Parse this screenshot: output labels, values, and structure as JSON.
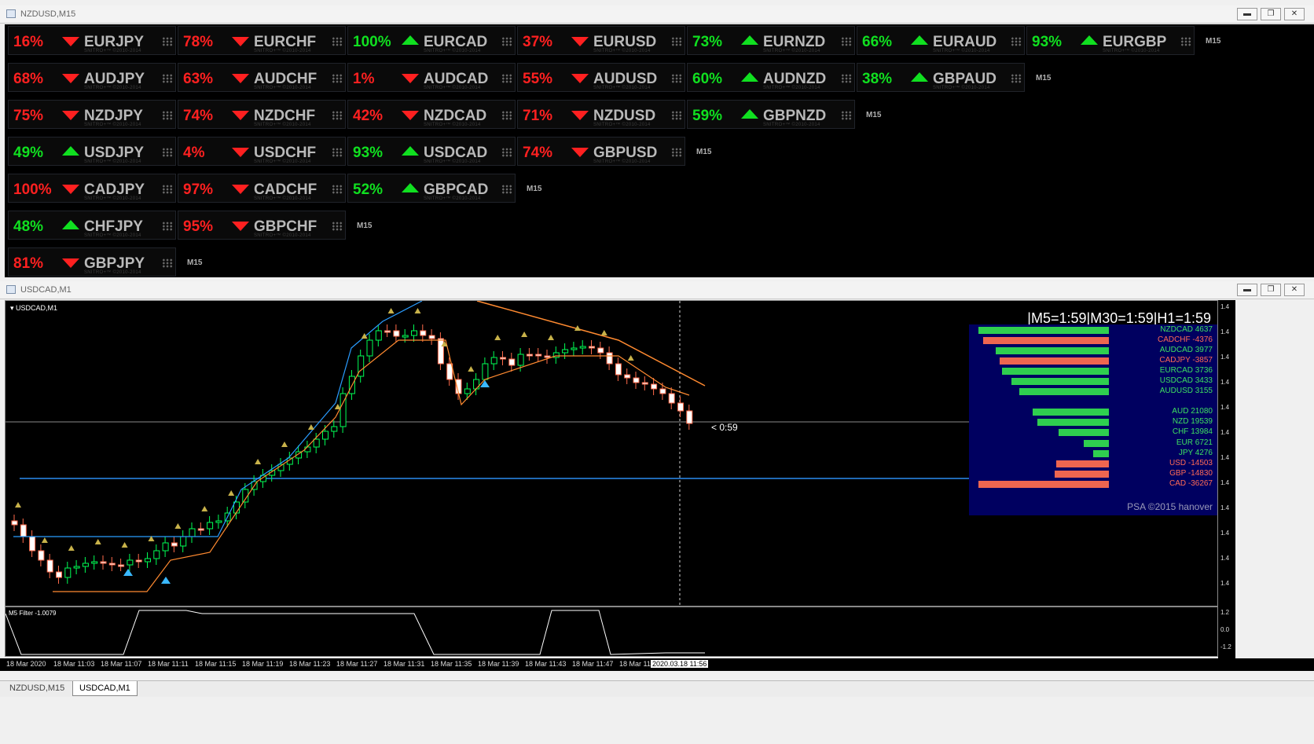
{
  "windows": {
    "top_title": "NZDUSD,M15",
    "bottom_title": "USDCAD,M1"
  },
  "watermark": "SNITRO+™ ©2010-2014",
  "tf_label": "M15",
  "colors": {
    "up": "#10e020",
    "down": "#ff2020",
    "bull": "#00ff66",
    "bear": "#ff6a4a",
    "panel": "#000060"
  },
  "rows": [
    [
      {
        "pct": "16%",
        "dir": "down",
        "pair": "EURJPY"
      },
      {
        "pct": "78%",
        "dir": "down",
        "pair": "EURCHF"
      },
      {
        "pct": "100%",
        "dir": "up",
        "pair": "EURCAD"
      },
      {
        "pct": "37%",
        "dir": "down",
        "pair": "EURUSD"
      },
      {
        "pct": "73%",
        "dir": "up",
        "pair": "EURNZD"
      },
      {
        "pct": "66%",
        "dir": "up",
        "pair": "EURAUD"
      },
      {
        "pct": "93%",
        "dir": "up",
        "pair": "EURGBP"
      }
    ],
    [
      {
        "pct": "68%",
        "dir": "down",
        "pair": "AUDJPY"
      },
      {
        "pct": "63%",
        "dir": "down",
        "pair": "AUDCHF"
      },
      {
        "pct": "1%",
        "dir": "down",
        "pair": "AUDCAD"
      },
      {
        "pct": "55%",
        "dir": "down",
        "pair": "AUDUSD"
      },
      {
        "pct": "60%",
        "dir": "up",
        "pair": "AUDNZD"
      },
      {
        "pct": "38%",
        "dir": "up",
        "pair": "GBPAUD"
      }
    ],
    [
      {
        "pct": "75%",
        "dir": "down",
        "pair": "NZDJPY"
      },
      {
        "pct": "74%",
        "dir": "down",
        "pair": "NZDCHF"
      },
      {
        "pct": "42%",
        "dir": "down",
        "pair": "NZDCAD"
      },
      {
        "pct": "71%",
        "dir": "down",
        "pair": "NZDUSD"
      },
      {
        "pct": "59%",
        "dir": "up",
        "pair": "GBPNZD"
      }
    ],
    [
      {
        "pct": "49%",
        "dir": "up",
        "pair": "USDJPY"
      },
      {
        "pct": "4%",
        "dir": "down",
        "pair": "USDCHF"
      },
      {
        "pct": "93%",
        "dir": "up",
        "pair": "USDCAD"
      },
      {
        "pct": "74%",
        "dir": "down",
        "pair": "GBPUSD"
      }
    ],
    [
      {
        "pct": "100%",
        "dir": "down",
        "pair": "CADJPY"
      },
      {
        "pct": "97%",
        "dir": "down",
        "pair": "CADCHF"
      },
      {
        "pct": "52%",
        "dir": "up",
        "pair": "GBPCAD"
      }
    ],
    [
      {
        "pct": "48%",
        "dir": "up",
        "pair": "CHFJPY"
      },
      {
        "pct": "95%",
        "dir": "down",
        "pair": "GBPCHF"
      }
    ],
    [
      {
        "pct": "81%",
        "dir": "down",
        "pair": "GBPJPY"
      }
    ]
  ],
  "chart": {
    "symbol_label": "USDCAD,M1",
    "countdown_header": "|M5=1:59|M30=1:59|H1=1:59",
    "bar_timer": "< 0:59",
    "filter_label": "M5 Filter -1.0079",
    "copyright": "PSA ©2015 hanover",
    "pairs": [
      {
        "name": "NZDCAD",
        "value": "4637",
        "dir": "up",
        "frac": 0.99
      },
      {
        "name": "CADCHF",
        "value": "-4376",
        "dir": "down",
        "frac": 0.95
      },
      {
        "name": "AUDCAD",
        "value": "3977",
        "dir": "up",
        "frac": 0.86
      },
      {
        "name": "CADJPY",
        "value": "-3857",
        "dir": "down",
        "frac": 0.83
      },
      {
        "name": "EURCAD",
        "value": "3736",
        "dir": "up",
        "frac": 0.81
      },
      {
        "name": "USDCAD",
        "value": "3433",
        "dir": "up",
        "frac": 0.74
      },
      {
        "name": "AUDUSD",
        "value": "3155",
        "dir": "up",
        "frac": 0.68
      }
    ],
    "currencies": [
      {
        "name": "AUD",
        "value": "21080",
        "dir": "up",
        "frac": 0.58
      },
      {
        "name": "NZD",
        "value": "19539",
        "dir": "up",
        "frac": 0.54
      },
      {
        "name": "CHF",
        "value": "13984",
        "dir": "up",
        "frac": 0.38
      },
      {
        "name": "EUR",
        "value": "6721",
        "dir": "up",
        "frac": 0.19
      },
      {
        "name": "JPY",
        "value": "4276",
        "dir": "up",
        "frac": 0.12
      },
      {
        "name": "USD",
        "value": "-14503",
        "dir": "down",
        "frac": 0.4
      },
      {
        "name": "GBP",
        "value": "-14830",
        "dir": "down",
        "frac": 0.41
      },
      {
        "name": "CAD",
        "value": "-36267",
        "dir": "down",
        "frac": 0.99
      }
    ],
    "price_labels": [
      "1.4",
      "1.4",
      "1.4",
      "1.4",
      "1.4",
      "1.4",
      "1.4",
      "1.4",
      "1.4",
      "1.4",
      "1.4",
      "1.4"
    ],
    "filter_scale": [
      "1.2",
      "0.0",
      "-1.2"
    ],
    "time_labels": [
      "18 Mar 2020",
      "18 Mar 11:03",
      "18 Mar 11:07",
      "18 Mar 11:11",
      "18 Mar 11:15",
      "18 Mar 11:19",
      "18 Mar 11:23",
      "18 Mar 11:27",
      "18 Mar 11:31",
      "18 Mar 11:35",
      "18 Mar 11:39",
      "18 Mar 11:43",
      "18 Mar 11:47",
      "18 Mar 11"
    ],
    "cursor_time": "2020.03.18 11:56"
  },
  "tabs": [
    "NZDUSD,M15",
    "USDCAD,M1"
  ]
}
